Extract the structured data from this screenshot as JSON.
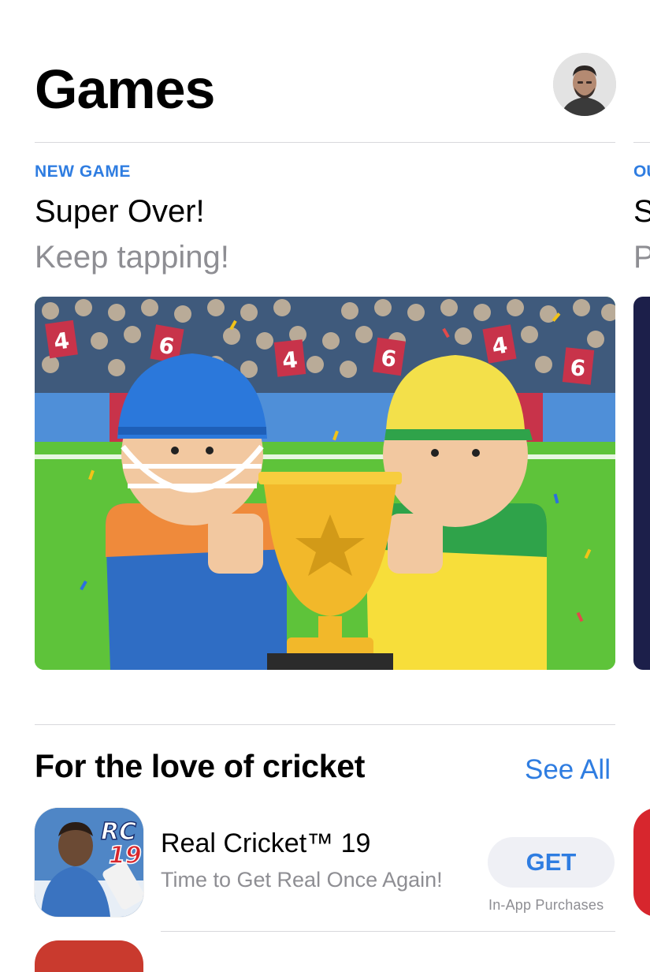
{
  "header": {
    "title": "Games"
  },
  "featured": {
    "kicker": "NEW GAME",
    "title": "Super Over!",
    "subtitle": "Keep tapping!",
    "peek": {
      "kicker": "OU",
      "title": "S",
      "subtitle": "P"
    }
  },
  "section": {
    "title": "For the love of cricket",
    "see_all_label": "See All",
    "apps": [
      {
        "name": "Real Cricket™ 19",
        "tagline": "Time to Get Real Once Again!",
        "action_label": "GET",
        "note": "In-App Purchases",
        "icon": "real-cricket-19-icon",
        "icon_text_main": "RC",
        "icon_text_sub": "19"
      }
    ]
  },
  "colors": {
    "accent": "#2f7de1",
    "secondary_text": "#8e8e93",
    "grass": "#5ec33a",
    "crowd": "#3f5a7c"
  }
}
